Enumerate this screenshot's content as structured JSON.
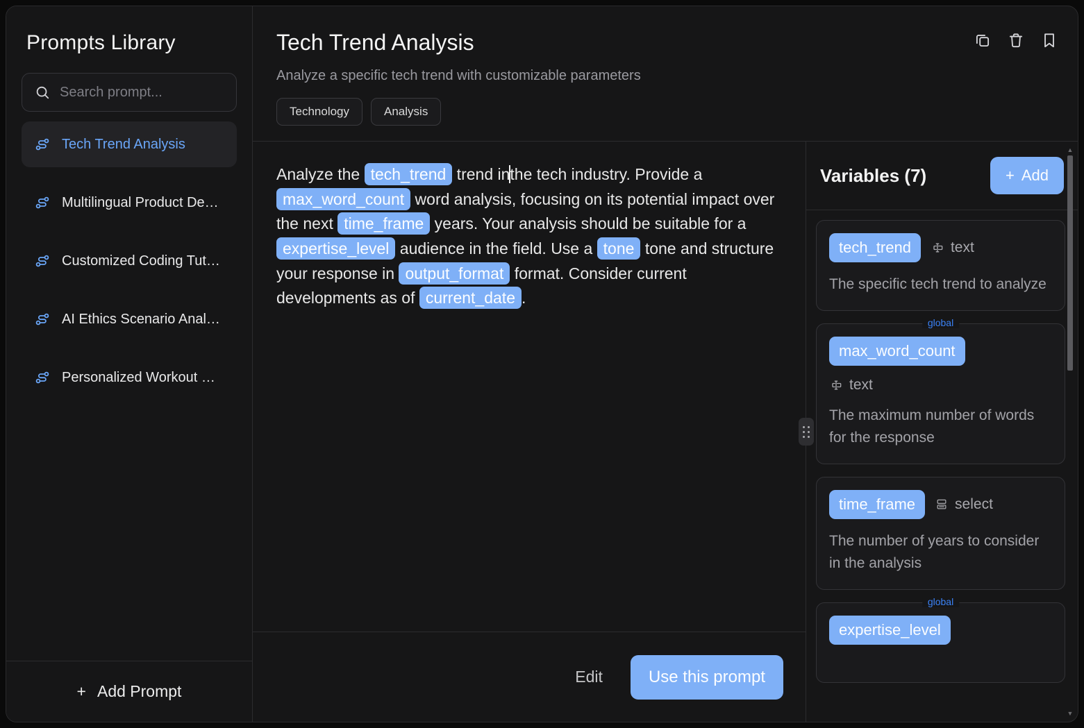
{
  "sidebar": {
    "title": "Prompts Library",
    "search": {
      "placeholder": "Search prompt...",
      "value": ""
    },
    "items": [
      {
        "label": "Tech Trend Analysis",
        "active": true
      },
      {
        "label": "Multilingual Product De…",
        "active": false
      },
      {
        "label": "Customized Coding Tut…",
        "active": false
      },
      {
        "label": "AI Ethics Scenario Anal…",
        "active": false
      },
      {
        "label": "Personalized Workout P…",
        "active": false
      }
    ],
    "add_prompt_label": "Add Prompt",
    "add_prompt_plus": "+"
  },
  "header": {
    "title": "Tech Trend Analysis",
    "subtitle": "Analyze a specific tech trend with customizable parameters",
    "tags": [
      "Technology",
      "Analysis"
    ],
    "actions": [
      {
        "name": "copy-icon",
        "title": "Copy"
      },
      {
        "name": "trash-icon",
        "title": "Delete"
      },
      {
        "name": "bookmark-icon",
        "title": "Bookmark"
      }
    ]
  },
  "prompt_body": {
    "segments": [
      {
        "type": "text",
        "value": "Analyze the "
      },
      {
        "type": "var",
        "value": "tech_trend"
      },
      {
        "type": "text",
        "value": " trend in"
      },
      {
        "type": "caret",
        "value": ""
      },
      {
        "type": "text",
        "value": "the tech industry. Provide a "
      },
      {
        "type": "var",
        "value": "max_word_count"
      },
      {
        "type": "text",
        "value": " word analysis, focusing on its potential impact over the next "
      },
      {
        "type": "var",
        "value": "time_frame"
      },
      {
        "type": "text",
        "value": " years. Your analysis should be suitable for a "
      },
      {
        "type": "var",
        "value": "expertise_level"
      },
      {
        "type": "text",
        "value": " audience in the field. Use a "
      },
      {
        "type": "var",
        "value": "tone"
      },
      {
        "type": "text",
        "value": " tone and structure your response in "
      },
      {
        "type": "var",
        "value": "output_format"
      },
      {
        "type": "text",
        "value": " format. Consider current developments as of "
      },
      {
        "type": "var",
        "value": "current_date"
      },
      {
        "type": "text",
        "value": "."
      }
    ]
  },
  "footer": {
    "edit_label": "Edit",
    "use_label": "Use this prompt"
  },
  "variables_panel": {
    "title": "Variables (7)",
    "add_label": "Add",
    "add_plus": "+",
    "global_badge": "global",
    "cards": [
      {
        "name": "tech_trend",
        "type": "text",
        "type_icon": "text-input-icon",
        "description": "The specific tech trend to analyze",
        "global": false,
        "type_inline": true
      },
      {
        "name": "max_word_count",
        "type": "text",
        "type_icon": "text-input-icon",
        "description": "The maximum number of words for the response",
        "global": true,
        "type_inline": false
      },
      {
        "name": "time_frame",
        "type": "select",
        "type_icon": "select-list-icon",
        "description": "The number of years to consider in the analysis",
        "global": false,
        "type_inline": true
      },
      {
        "name": "expertise_level",
        "type": "",
        "type_icon": "",
        "description": "",
        "global": true,
        "type_inline": true
      }
    ]
  },
  "colors": {
    "accent": "#7fb0f7",
    "accent_text": "#6aa6f8",
    "global_label": "#3b82f6",
    "app_bg": "#161617",
    "card_bg": "#1a1a1c",
    "border": "#2c2c2e"
  }
}
